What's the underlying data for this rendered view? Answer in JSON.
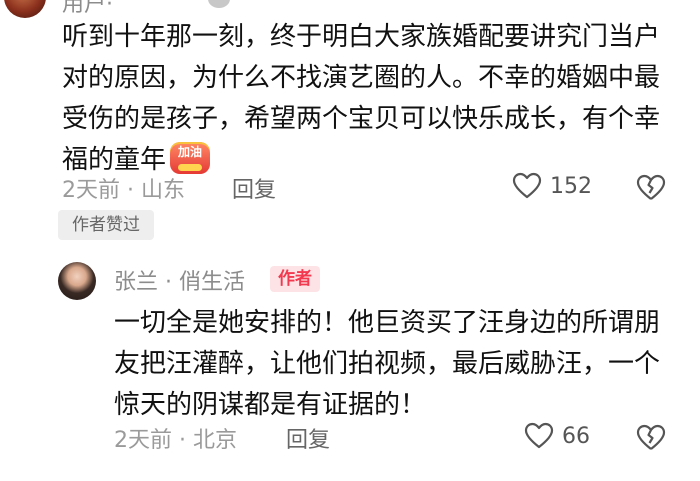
{
  "top_comment": {
    "author_partial": "用户·",
    "text": "听到十年那一刻，终于明白大家族婚配要讲究门当户对的原因，为什么不找演艺圈的人。不幸的婚姻中最受伤的是孩子，希望两个宝贝可以快乐成长，有个幸福的童年",
    "emoji_label": "加油",
    "time": "2天前",
    "location": "山东",
    "time_location": "2天前 · 山东",
    "reply_label": "回复",
    "like_count": "152",
    "author_liked_label": "作者赞过"
  },
  "reply_comment": {
    "author": "张兰 · 俏生活",
    "author_badge": "作者",
    "text": "一切全是她安排的！他巨资买了汪身边的所谓朋友把汪灌醉，让他们拍视频，最后威胁汪，一个惊天的阴谋都是有证据的！",
    "time_location": "2天前 · 北京",
    "reply_label": "回复",
    "like_count": "66"
  },
  "icons": {
    "like": "heart-outline-icon",
    "dislike": "broken-heart-icon"
  },
  "colors": {
    "text": "#111111",
    "meta": "#9a9a9a",
    "badge_bg": "#fde3e6",
    "badge_text": "#f2394f",
    "author_liked_bg": "#eeeeee"
  }
}
